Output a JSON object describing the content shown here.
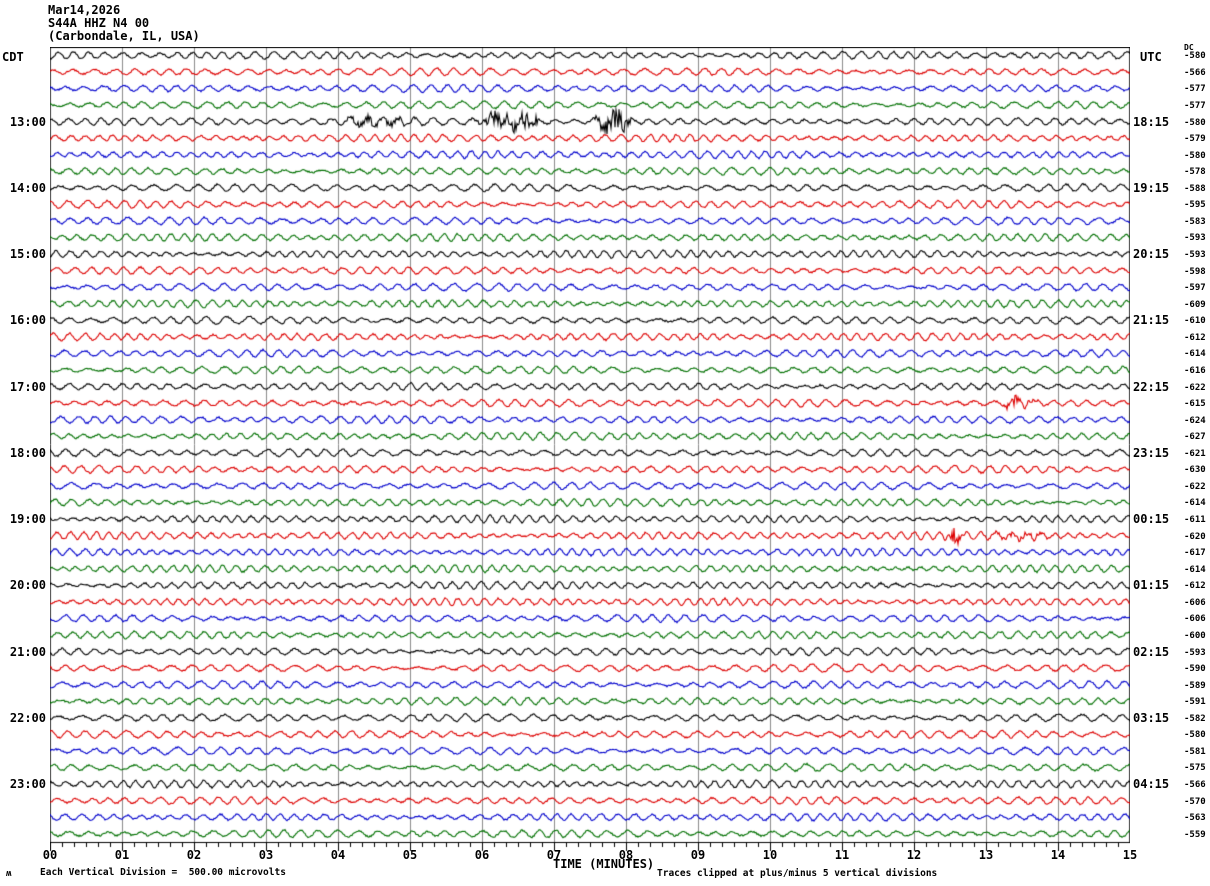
{
  "header": {
    "date": "Mar14,2026",
    "station": "S44A HHZ N4 00",
    "location": "(Carbondale, IL, USA)"
  },
  "axes": {
    "left_tz": "CDT",
    "right_tz": "UTC",
    "dc_label": "DC",
    "x_title": "TIME (MINUTES)",
    "x_ticks": [
      "00",
      "01",
      "02",
      "03",
      "04",
      "05",
      "06",
      "07",
      "08",
      "09",
      "10",
      "11",
      "12",
      "13",
      "14",
      "15"
    ],
    "footer_left": "Each Vertical Division =  500.00 microvolts",
    "footer_right": "Traces clipped at plus/minus 5 vertical divisions",
    "corner_mark": "ʍ"
  },
  "colors": {
    "black": "#000000",
    "red": "#dd0000",
    "blue": "#0000cc",
    "green": "#007000",
    "grid": "#8a8a8a",
    "border": "#444444",
    "top_border": "#000000"
  },
  "chart_data": {
    "type": "seismogram_helicorder",
    "title": "S44A HHZ N4 00 (Carbondale, IL, USA) Mar14,2026",
    "x_axis": {
      "label": "TIME (MINUTES)",
      "min": 0,
      "max": 15,
      "major_tick_every_min": 1,
      "minor_ticks_per_major": 6
    },
    "row_duration_minutes": 15,
    "amplitude_scale": "Each Vertical Division = 500.00 microvolts",
    "clipping": "Traces clipped at plus/minus 5 vertical divisions",
    "color_cycle": [
      "black",
      "red",
      "blue",
      "green"
    ],
    "rows": [
      {
        "color": "black",
        "cdt": "",
        "utc": "",
        "dc": "-580"
      },
      {
        "color": "red",
        "cdt": "",
        "utc": "",
        "dc": "-566"
      },
      {
        "color": "blue",
        "cdt": "",
        "utc": "",
        "dc": "-577"
      },
      {
        "color": "green",
        "cdt": "",
        "utc": "",
        "dc": "-577"
      },
      {
        "color": "black",
        "cdt": "13:00",
        "utc": "18:15",
        "dc": "-580"
      },
      {
        "color": "red",
        "cdt": "",
        "utc": "",
        "dc": "-579"
      },
      {
        "color": "blue",
        "cdt": "",
        "utc": "",
        "dc": "-580"
      },
      {
        "color": "green",
        "cdt": "",
        "utc": "",
        "dc": "-578"
      },
      {
        "color": "black",
        "cdt": "14:00",
        "utc": "19:15",
        "dc": "-588"
      },
      {
        "color": "red",
        "cdt": "",
        "utc": "",
        "dc": "-595"
      },
      {
        "color": "blue",
        "cdt": "",
        "utc": "",
        "dc": "-583"
      },
      {
        "color": "green",
        "cdt": "",
        "utc": "",
        "dc": "-593"
      },
      {
        "color": "black",
        "cdt": "15:00",
        "utc": "20:15",
        "dc": "-593"
      },
      {
        "color": "red",
        "cdt": "",
        "utc": "",
        "dc": "-598"
      },
      {
        "color": "blue",
        "cdt": "",
        "utc": "",
        "dc": "-597"
      },
      {
        "color": "green",
        "cdt": "",
        "utc": "",
        "dc": "-609"
      },
      {
        "color": "black",
        "cdt": "16:00",
        "utc": "21:15",
        "dc": "-610"
      },
      {
        "color": "red",
        "cdt": "",
        "utc": "",
        "dc": "-612"
      },
      {
        "color": "blue",
        "cdt": "",
        "utc": "",
        "dc": "-614"
      },
      {
        "color": "green",
        "cdt": "",
        "utc": "",
        "dc": "-616"
      },
      {
        "color": "black",
        "cdt": "17:00",
        "utc": "22:15",
        "dc": "-622"
      },
      {
        "color": "red",
        "cdt": "",
        "utc": "",
        "dc": "-615"
      },
      {
        "color": "blue",
        "cdt": "",
        "utc": "",
        "dc": "-624"
      },
      {
        "color": "green",
        "cdt": "",
        "utc": "",
        "dc": "-627"
      },
      {
        "color": "black",
        "cdt": "18:00",
        "utc": "23:15",
        "dc": "-621"
      },
      {
        "color": "red",
        "cdt": "",
        "utc": "",
        "dc": "-630"
      },
      {
        "color": "blue",
        "cdt": "",
        "utc": "",
        "dc": "-622"
      },
      {
        "color": "green",
        "cdt": "",
        "utc": "",
        "dc": "-614"
      },
      {
        "color": "black",
        "cdt": "19:00",
        "utc": "00:15",
        "dc": "-611"
      },
      {
        "color": "red",
        "cdt": "",
        "utc": "",
        "dc": "-620"
      },
      {
        "color": "blue",
        "cdt": "",
        "utc": "",
        "dc": "-617"
      },
      {
        "color": "green",
        "cdt": "",
        "utc": "",
        "dc": "-614"
      },
      {
        "color": "black",
        "cdt": "20:00",
        "utc": "01:15",
        "dc": "-612"
      },
      {
        "color": "red",
        "cdt": "",
        "utc": "",
        "dc": "-606"
      },
      {
        "color": "blue",
        "cdt": "",
        "utc": "",
        "dc": "-606"
      },
      {
        "color": "green",
        "cdt": "",
        "utc": "",
        "dc": "-600"
      },
      {
        "color": "black",
        "cdt": "21:00",
        "utc": "02:15",
        "dc": "-593"
      },
      {
        "color": "red",
        "cdt": "",
        "utc": "",
        "dc": "-590"
      },
      {
        "color": "blue",
        "cdt": "",
        "utc": "",
        "dc": "-589"
      },
      {
        "color": "green",
        "cdt": "",
        "utc": "",
        "dc": "-591"
      },
      {
        "color": "black",
        "cdt": "22:00",
        "utc": "03:15",
        "dc": "-582"
      },
      {
        "color": "red",
        "cdt": "",
        "utc": "",
        "dc": "-580"
      },
      {
        "color": "blue",
        "cdt": "",
        "utc": "",
        "dc": "-581"
      },
      {
        "color": "green",
        "cdt": "",
        "utc": "",
        "dc": "-575"
      },
      {
        "color": "black",
        "cdt": "23:00",
        "utc": "04:15",
        "dc": "-566"
      },
      {
        "color": "red",
        "cdt": "",
        "utc": "",
        "dc": "-570"
      },
      {
        "color": "blue",
        "cdt": "",
        "utc": "",
        "dc": "-563"
      },
      {
        "color": "green",
        "cdt": "",
        "utc": "",
        "dc": "-559"
      }
    ],
    "events": [
      {
        "row": 5,
        "start_min": 3.7,
        "end_min": 5.3,
        "amp": 3,
        "note": "moderate burst on 13:00 CDT trace"
      },
      {
        "row": 5,
        "start_min": 5.85,
        "end_min": 6.9,
        "amp": 10,
        "note": "large clipped burst"
      },
      {
        "row": 5,
        "start_min": 7.5,
        "end_min": 8.15,
        "amp": 11,
        "note": "large clipped burst"
      },
      {
        "row": 22,
        "start_min": 13.15,
        "end_min": 13.75,
        "amp": 6,
        "note": "burst on red trace after 17:00 CDT"
      },
      {
        "row": 30,
        "start_min": 12.4,
        "end_min": 12.75,
        "amp": 8,
        "note": "sharp spike on red trace after 19:00 CDT"
      },
      {
        "row": 30,
        "start_min": 12.95,
        "end_min": 14.0,
        "amp": 3,
        "note": "elevated activity"
      }
    ]
  }
}
